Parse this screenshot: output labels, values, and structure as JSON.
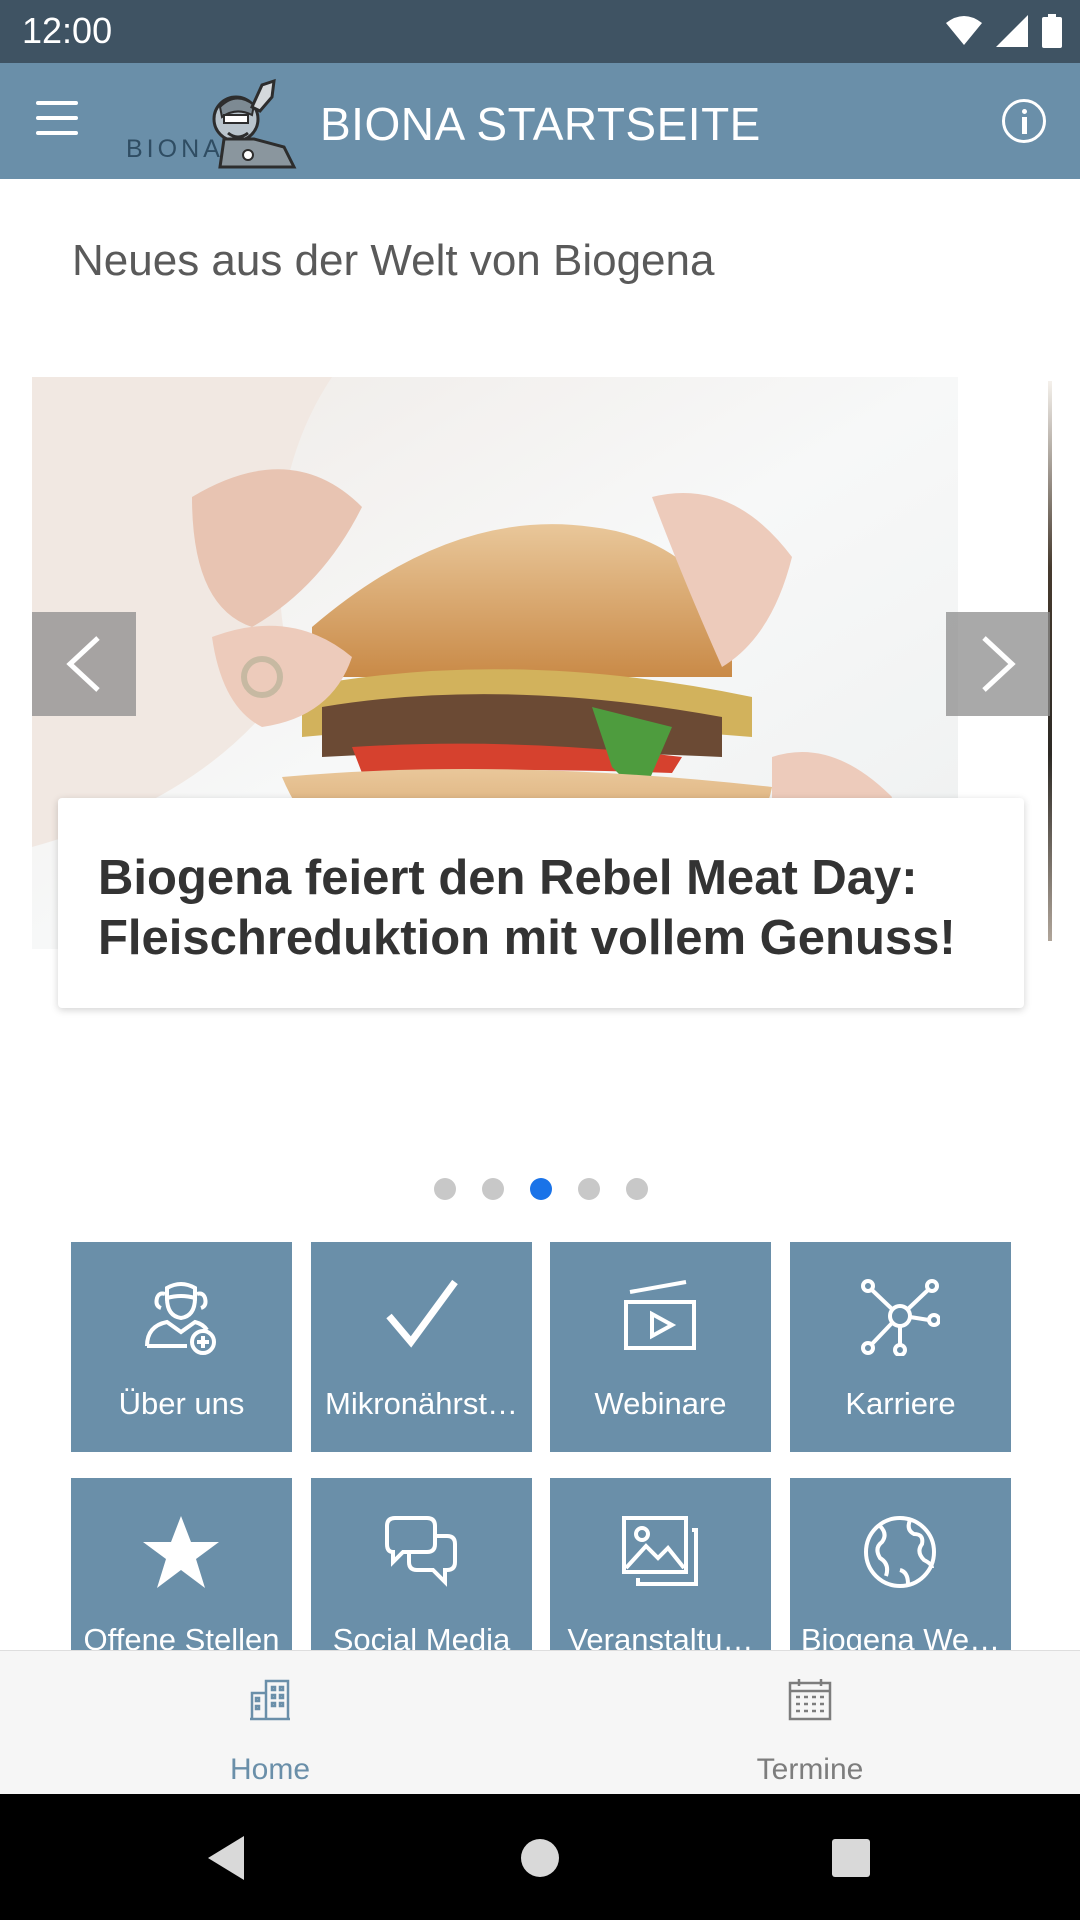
{
  "status_bar": {
    "time": "12:00"
  },
  "app_bar": {
    "logo_text": "BIONA",
    "title": "BIONA STARTSEITE"
  },
  "section": {
    "title": "Neues aus der Welt von Biogena"
  },
  "carousel": {
    "caption": "Biogena feiert den Rebel Meat Day: Fleischreduktion mit vollem Genuss!",
    "slide_count": 5,
    "active_index": 2
  },
  "tiles": [
    {
      "label": "Über uns",
      "icon": "doctor-add-icon"
    },
    {
      "label": "Mikronährst…",
      "icon": "checkmark-icon"
    },
    {
      "label": "Webinare",
      "icon": "video-play-icon"
    },
    {
      "label": "Karriere",
      "icon": "network-icon"
    },
    {
      "label": "Offene Stellen",
      "icon": "star-icon"
    },
    {
      "label": "Social Media",
      "icon": "chat-bubbles-icon"
    },
    {
      "label": "Veranstaltu…",
      "icon": "image-gallery-icon"
    },
    {
      "label": "Biogena We…",
      "icon": "globe-icon"
    }
  ],
  "bottom_nav": {
    "home_label": "Home",
    "termine_label": "Termine",
    "active": "home"
  },
  "colors": {
    "app_bar": "#6a8fa9",
    "status_bar": "#3f5363",
    "tile": "#6a8fa9",
    "dot_active": "#1a73e8",
    "nav_active": "#6a8fa9",
    "nav_inactive": "#7d7d7d"
  }
}
